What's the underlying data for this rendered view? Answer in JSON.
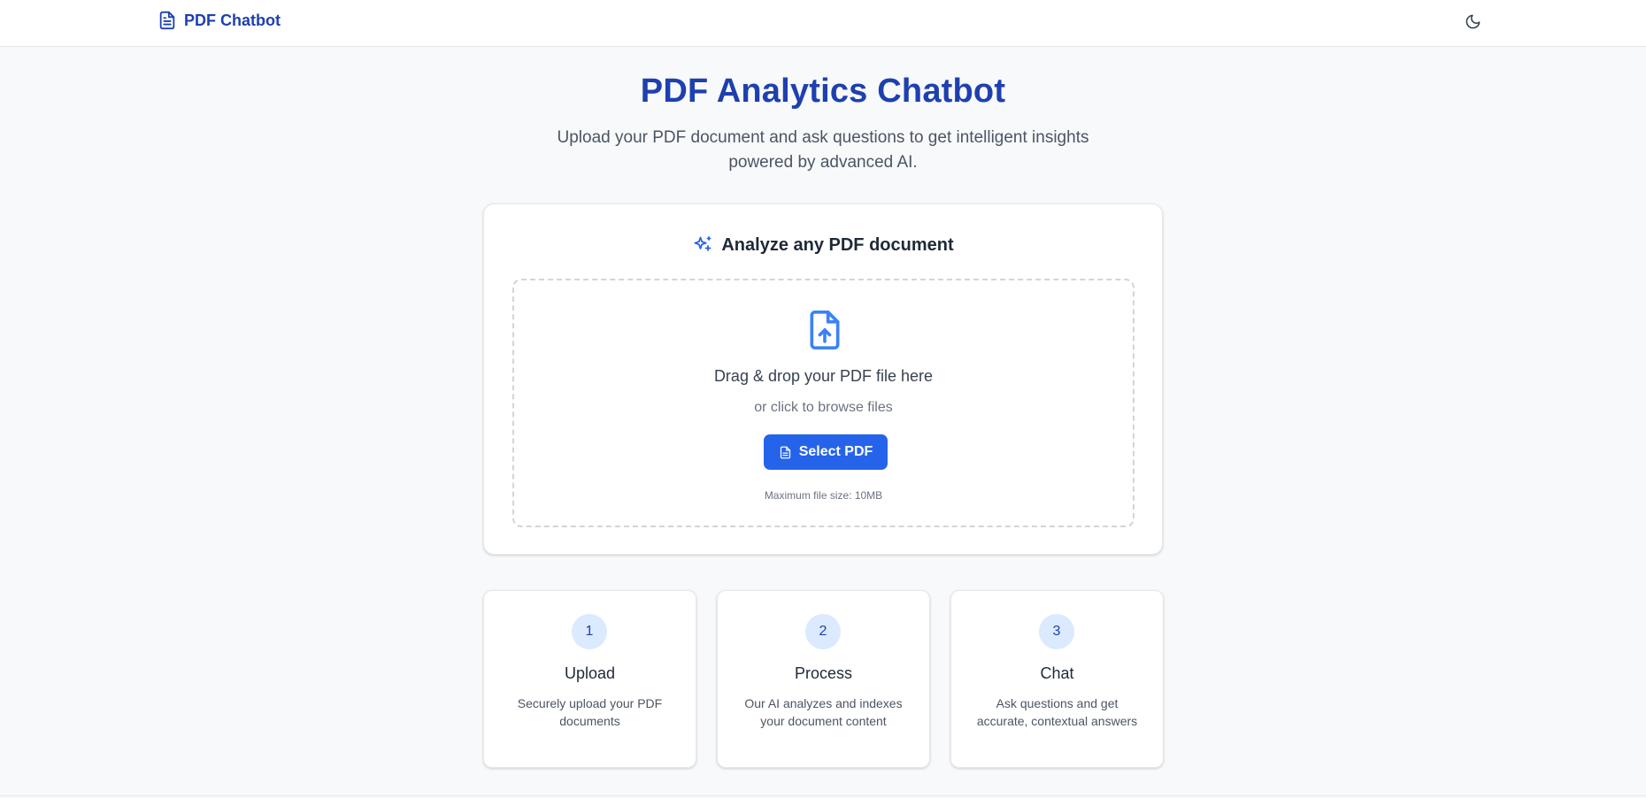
{
  "navbar": {
    "brand": "PDF Chatbot",
    "brand_icon": "file-text-icon",
    "theme_toggle_icon": "moon-icon"
  },
  "hero": {
    "title": "PDF Analytics Chatbot",
    "subtitle": "Upload your PDF document and ask questions to get intelligent insights powered by advanced AI."
  },
  "upload_card": {
    "title": "Analyze any PDF document",
    "title_icon": "sparkles-icon",
    "dropzone": {
      "icon": "file-upload-icon",
      "heading": "Drag & drop your PDF file here",
      "subheading": "or click to browse files",
      "button_label": "Select PDF",
      "button_icon": "file-text-icon",
      "hint": "Maximum file size: 10MB"
    }
  },
  "steps": [
    {
      "number": "1",
      "title": "Upload",
      "description": "Securely upload your PDF documents"
    },
    {
      "number": "2",
      "title": "Process",
      "description": "Our AI analyzes and indexes your document content"
    },
    {
      "number": "3",
      "title": "Chat",
      "description": "Ask questions and get accurate, contextual answers"
    }
  ],
  "colors": {
    "primary": "#1e40af",
    "accent": "#2563eb",
    "icon_blue": "#3b82f6",
    "step_circle": "#dbeafe",
    "background": "#f8f9fb"
  }
}
